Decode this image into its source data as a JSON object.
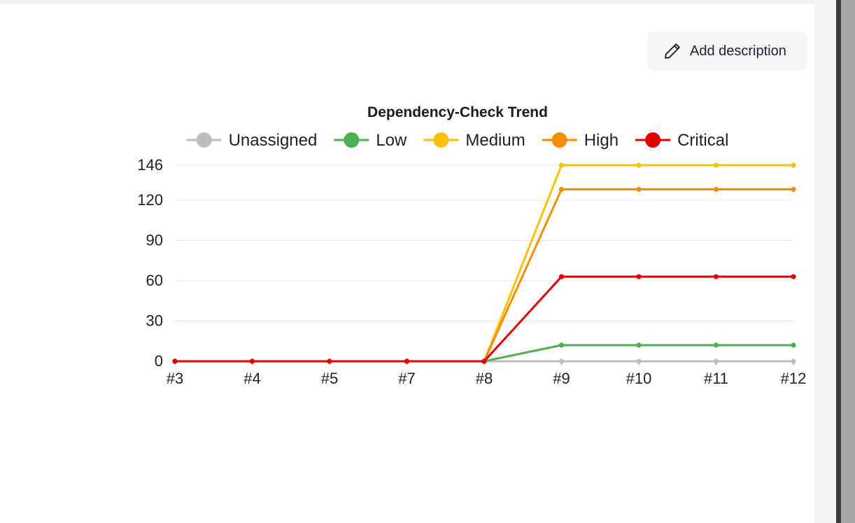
{
  "toolbar": {
    "add_description_label": "Add description"
  },
  "icons": {
    "add_description": "pencil-icon"
  },
  "chart_data": {
    "type": "line",
    "title": "Dependency-Check Trend",
    "categories": [
      "#3",
      "#4",
      "#5",
      "#7",
      "#8",
      "#9",
      "#10",
      "#11",
      "#12"
    ],
    "yticks": [
      0,
      30,
      60,
      90,
      120,
      146
    ],
    "ylim": [
      0,
      146
    ],
    "grid": true,
    "legend_position": "top",
    "series": [
      {
        "name": "Unassigned",
        "color": "#bdbdbd",
        "values": [
          0,
          0,
          0,
          0,
          0,
          0,
          0,
          0,
          0
        ]
      },
      {
        "name": "Low",
        "color": "#4caf50",
        "values": [
          0,
          0,
          0,
          0,
          0,
          12,
          12,
          12,
          12
        ]
      },
      {
        "name": "Medium",
        "color": "#fbc108",
        "values": [
          0,
          0,
          0,
          0,
          0,
          146,
          146,
          146,
          146
        ]
      },
      {
        "name": "High",
        "color": "#fb8c00",
        "values": [
          0,
          0,
          0,
          0,
          0,
          128,
          128,
          128,
          128
        ]
      },
      {
        "name": "Critical",
        "color": "#e00000",
        "values": [
          0,
          0,
          0,
          0,
          0,
          63,
          63,
          63,
          63
        ]
      }
    ]
  }
}
